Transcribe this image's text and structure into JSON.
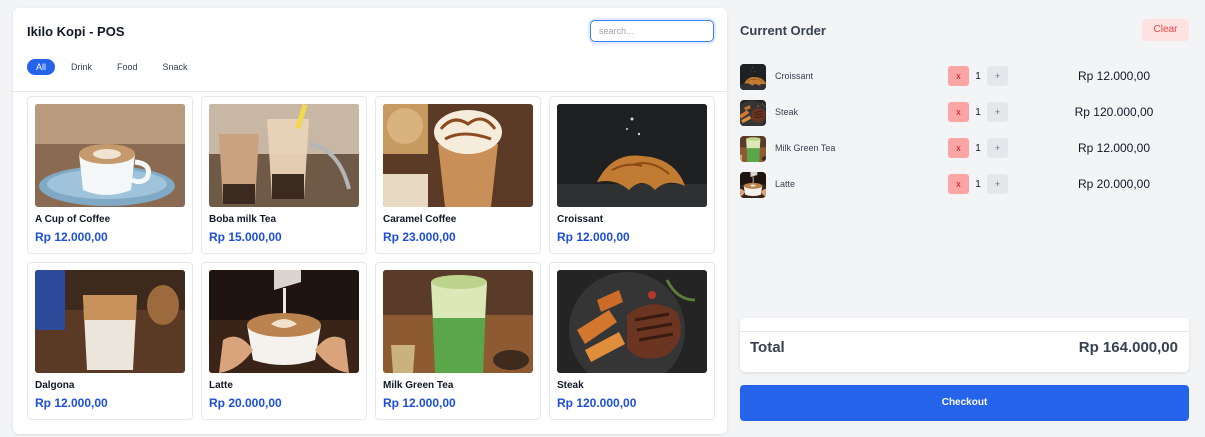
{
  "app": {
    "title": "Ikilo Kopi - POS",
    "search_placeholder": "search...",
    "filters": [
      {
        "label": "All",
        "active": true
      },
      {
        "label": "Drink",
        "active": false
      },
      {
        "label": "Food",
        "active": false
      },
      {
        "label": "Snack",
        "active": false
      }
    ]
  },
  "products": [
    {
      "name": "A Cup of Coffee",
      "price": "Rp 12.000,00",
      "image": "coffee-cup-image"
    },
    {
      "name": "Boba milk Tea",
      "price": "Rp 15.000,00",
      "image": "boba-tea-image"
    },
    {
      "name": "Caramel Coffee",
      "price": "Rp 23.000,00",
      "image": "caramel-coffee-image"
    },
    {
      "name": "Croissant",
      "price": "Rp 12.000,00",
      "image": "croissant-image"
    },
    {
      "name": "Dalgona",
      "price": "Rp 12.000,00",
      "image": "dalgona-image"
    },
    {
      "name": "Latte",
      "price": "Rp 20.000,00",
      "image": "latte-image"
    },
    {
      "name": "Milk Green Tea",
      "price": "Rp 12.000,00",
      "image": "green-tea-image"
    },
    {
      "name": "Steak",
      "price": "Rp 120.000,00",
      "image": "steak-image"
    }
  ],
  "order": {
    "title": "Current Order",
    "clear_label": "Clear",
    "items": [
      {
        "name": "Croissant",
        "qty": "1",
        "price": "Rp 12.000,00",
        "remove_label": "x",
        "add_label": "+"
      },
      {
        "name": "Steak",
        "qty": "1",
        "price": "Rp 120.000,00",
        "remove_label": "x",
        "add_label": "+"
      },
      {
        "name": "Milk Green Tea",
        "qty": "1",
        "price": "Rp 12.000,00",
        "remove_label": "x",
        "add_label": "+"
      },
      {
        "name": "Latte",
        "qty": "1",
        "price": "Rp 20.000,00",
        "remove_label": "x",
        "add_label": "+"
      }
    ],
    "total_label": "Total",
    "total_value": "Rp 164.000,00",
    "checkout_label": "Checkout"
  },
  "colors": {
    "accent": "#2563eb",
    "price": "#1d4ed8",
    "clear_bg": "#fee2e2",
    "clear_text": "#ef4444",
    "remove_bg": "#fca5a5"
  }
}
